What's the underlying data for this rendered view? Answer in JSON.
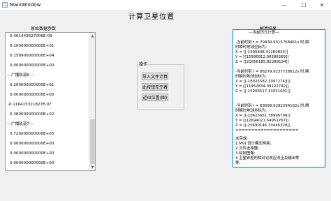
{
  "window": {
    "title": "MainWindow",
    "minimize_glyph": "—",
    "maximize_glyph": "☐",
    "close_glyph": "✕"
  },
  "header": {
    "title": "计算卫星位置"
  },
  "left_panel": {
    "label": "原始数据参数",
    "lines": [
      "0.361443627006E-09",
      "0.100000000000E+01",
      "0.158900000000E+04",
      "0.000000000000E+00",
      "---广播轨道6---",
      "0.200000000000E+01",
      "0.000000000000E+00",
      "-0.116415321827E-07",
      "0.380000000000E+02",
      "---广播轨道7---",
      "0.720000000000E+05",
      "0.000000000000E+00",
      "0.000000000000E+00",
      "0.000000000000E+00"
    ],
    "scroll_up_glyph": "▲",
    "scroll_down_glyph": "▼"
  },
  "operations": {
    "group_title": "操作",
    "buttons": [
      "导入文件计算",
      "此按钮无空着",
      "近似位置(图)"
    ]
  },
  "right_panel": {
    "label": "解算结果",
    "lines": [
      "---当前历元计算---",
      "",
      "-当前时刻 t = 79439.9315768461s 时,瞬",
      "时瞬时地球坐标为:",
      "X = [[-1005648.41260824]]",
      "Y = [[15586912.90586269]]",
      "Z = [[21656185.82289194]]",
      "",
      "-当前时刻 t = 86279.9237728612s 时,瞬",
      "时瞬时地球坐标为:",
      "X = [[-18025582.10972743]]",
      "Y = [[11952834.09122742]]",
      "Z = [[-15266517.31051001]]",
      "",
      "-当前时刻 t = 83099.9292294162s 时,瞬",
      "时瞬时地球坐标为:",
      "X = [[-10625651.78996706]]",
      "Y = [[12694021.64951767]]",
      "Z = [[-20690146.33446328]]",
      "  ====================",
      "  未完成:",
      "  1.MVC设计模式构架;",
      "  2.文件选择器;",
      "  3.绘制图像;",
      "  4.卫星钟差的相对论效应改正及输出等",
      "  等。"
    ]
  }
}
